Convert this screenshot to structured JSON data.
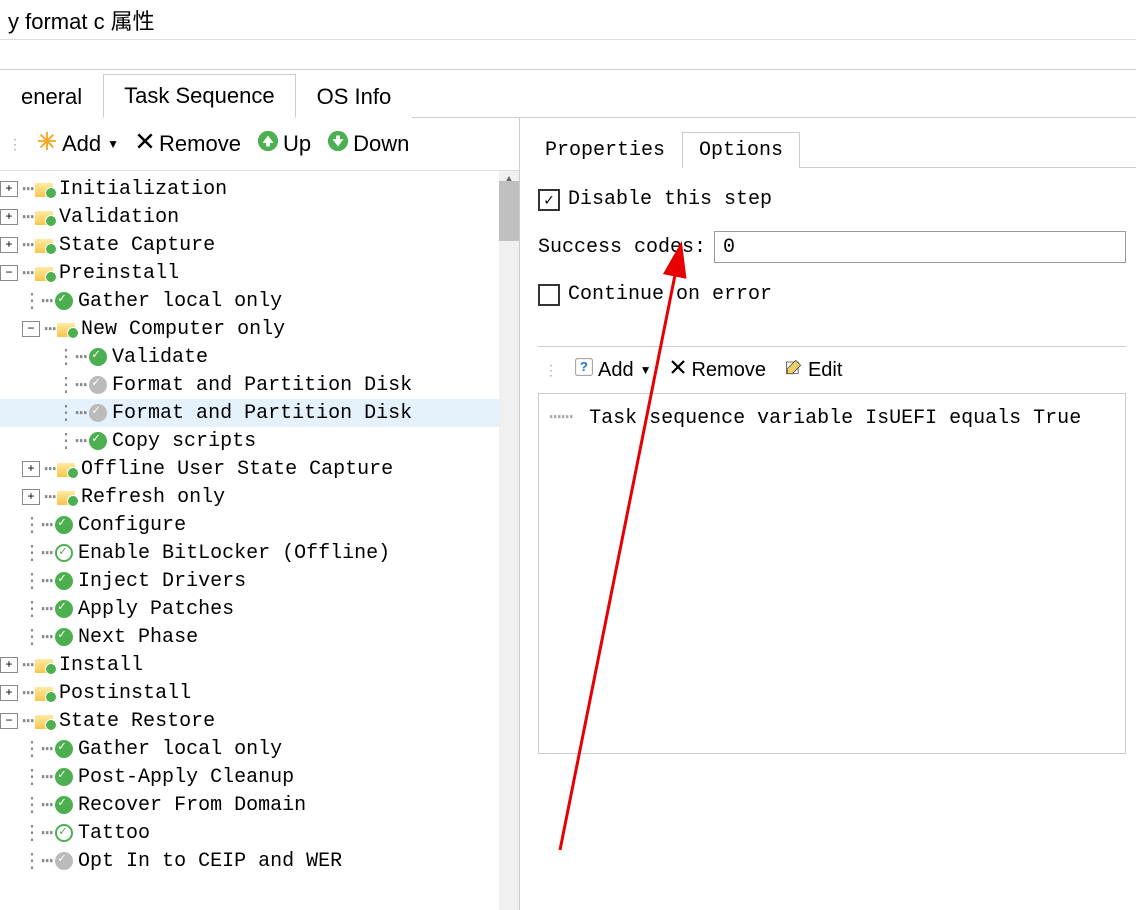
{
  "window": {
    "title": "y format c 属性"
  },
  "mainTabs": {
    "general": "eneral",
    "taskSequence": "Task Sequence",
    "osInfo": "OS Info"
  },
  "leftToolbar": {
    "add": "Add",
    "remove": "Remove",
    "up": "Up",
    "down": "Down"
  },
  "tree": {
    "initialization": "Initialization",
    "validation": "Validation",
    "stateCapture": "State Capture",
    "preinstall": "Preinstall",
    "gatherLocalOnly": "Gather local only",
    "newComputerOnly": "New Computer only",
    "validate": "Validate",
    "formatPartition1": "Format and Partition Disk",
    "formatPartition2": "Format and Partition Disk",
    "copyScripts": "Copy scripts",
    "offlineUserState": "Offline User State Capture",
    "refreshOnly": "Refresh only",
    "configure": "Configure",
    "enableBitlocker": "Enable BitLocker (Offline)",
    "injectDrivers": "Inject Drivers",
    "applyPatches": "Apply Patches",
    "nextPhase": "Next Phase",
    "install": "Install",
    "postinstall": "Postinstall",
    "stateRestore": "State Restore",
    "gatherLocalOnly2": "Gather local only",
    "postApplyCleanup": "Post-Apply Cleanup",
    "recoverFromDomain": "Recover From Domain",
    "tattoo": "Tattoo",
    "optInCeip": "Opt In to CEIP and WER"
  },
  "subTabs": {
    "properties": "Properties",
    "options": "Options"
  },
  "options": {
    "disableStep": "Disable this step",
    "successCodesLabel": "Success codes:",
    "successCodesValue": "0",
    "continueOnError": "Continue on error"
  },
  "condToolbar": {
    "add": "Add",
    "remove": "Remove",
    "edit": "Edit"
  },
  "condition": "Task sequence variable IsUEFI equals True"
}
